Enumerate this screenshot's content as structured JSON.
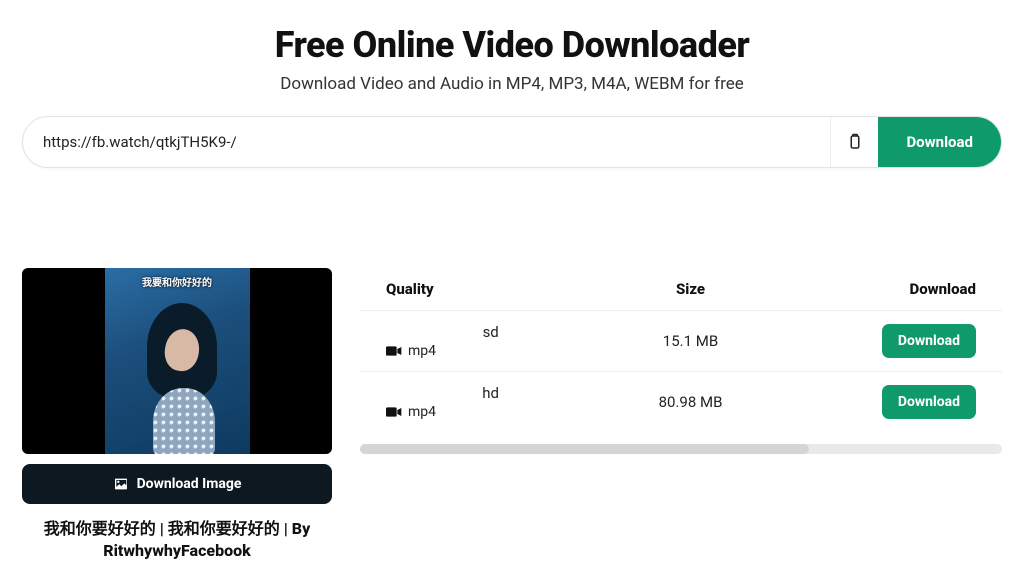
{
  "header": {
    "title": "Free Online Video Downloader",
    "subtitle": "Download Video and Audio in MP4, MP3, M4A, WEBM for free"
  },
  "input": {
    "value": "https://fb.watch/qtkjTH5K9-/",
    "download_label": "Download"
  },
  "video": {
    "caption_overlay": "我要和你好好的",
    "download_image_label": "Download Image",
    "title": "我和你要好好的 | 我和你要好好的 | By RitwhywhyFacebook"
  },
  "table": {
    "headers": {
      "quality": "Quality",
      "size": "Size",
      "download": "Download"
    },
    "rows": [
      {
        "quality": "sd",
        "format": "mp4",
        "size": "15.1 MB",
        "download_label": "Download"
      },
      {
        "quality": "hd",
        "format": "mp4",
        "size": "80.98 MB",
        "download_label": "Download"
      }
    ]
  },
  "colors": {
    "accent": "#0f9a6c",
    "dark": "#0e1821"
  }
}
